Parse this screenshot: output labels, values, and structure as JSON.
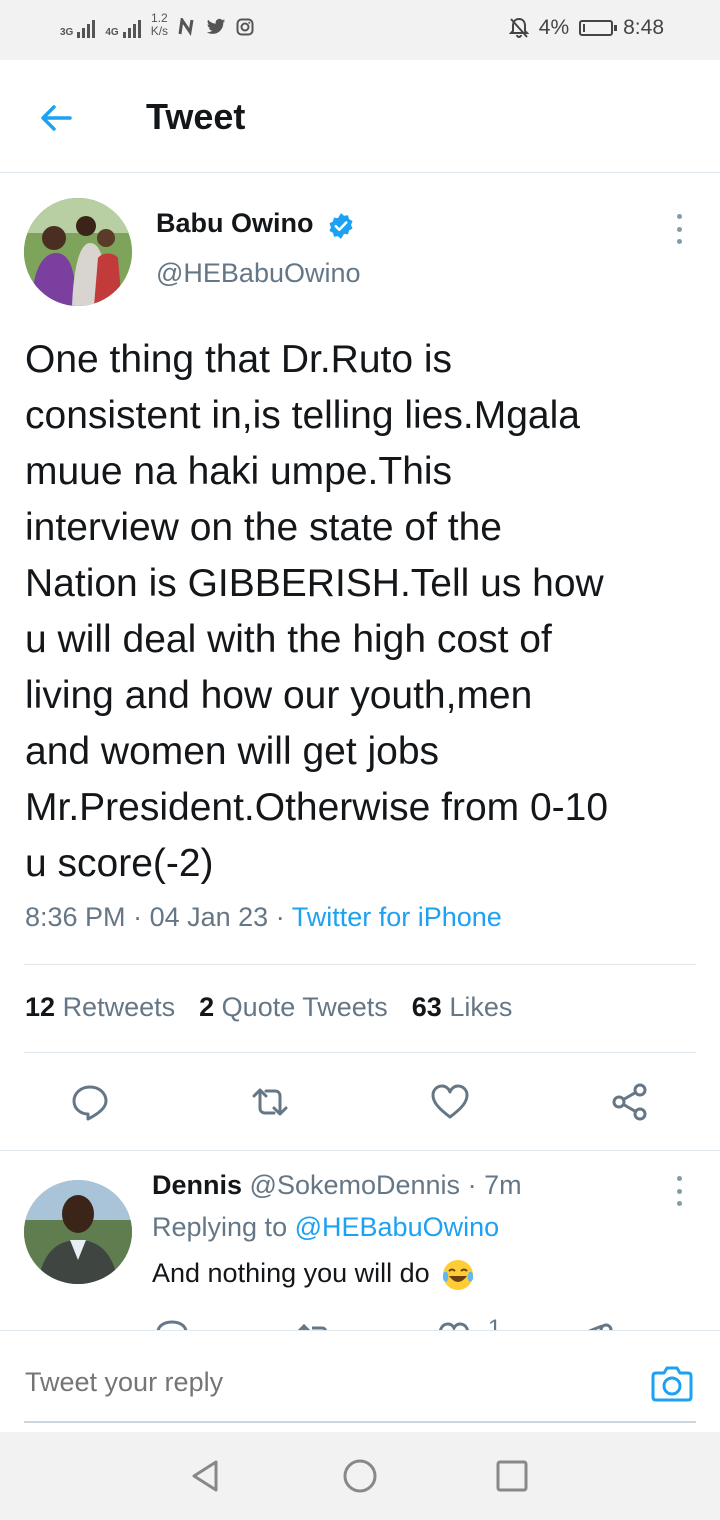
{
  "status_bar": {
    "network1": "3G",
    "network2": "4G",
    "speed_value": "1.2",
    "speed_unit": "K/s",
    "app_icons": [
      "n-app-icon",
      "twitter-icon",
      "instagram-icon"
    ],
    "battery_percent": "4%",
    "battery_level": 0.04,
    "time": "8:48"
  },
  "header": {
    "title": "Tweet"
  },
  "tweet": {
    "author_name": "Babu Owino",
    "verified": true,
    "handle": "@HEBabuOwino",
    "text": "One thing that Dr.Ruto is\nconsistent in,is telling lies.Mgala\nmuue na haki umpe.This\ninterview on the state of the\nNation is GIBBERISH.Tell us how\nu will deal with the high cost of\nliving and how our youth,men\nand women will get jobs\nMr.President.Otherwise from 0-10\nu score(-2)",
    "time": "8:36 PM",
    "date": "04 Jan 23",
    "separator": "·",
    "source": "Twitter for iPhone",
    "retweets_count": "12",
    "retweets_label": "Retweets",
    "quotes_count": "2",
    "quotes_label": "Quote Tweets",
    "likes_count": "63",
    "likes_label": "Likes"
  },
  "reply": {
    "name": "Dennis",
    "handle": "@SokemoDennis",
    "separator": "·",
    "time_ago": "7m",
    "replying_prefix": "Replying to",
    "replying_to": "@HEBabuOwino",
    "text": "And nothing you will do",
    "emoji": "face-with-tears-of-joy",
    "likes_count": "1"
  },
  "reply_bar": {
    "placeholder": "Tweet your reply"
  },
  "colors": {
    "accent": "#1da1f2",
    "secondary_text": "#657786",
    "divider": "#e1e8ed"
  }
}
